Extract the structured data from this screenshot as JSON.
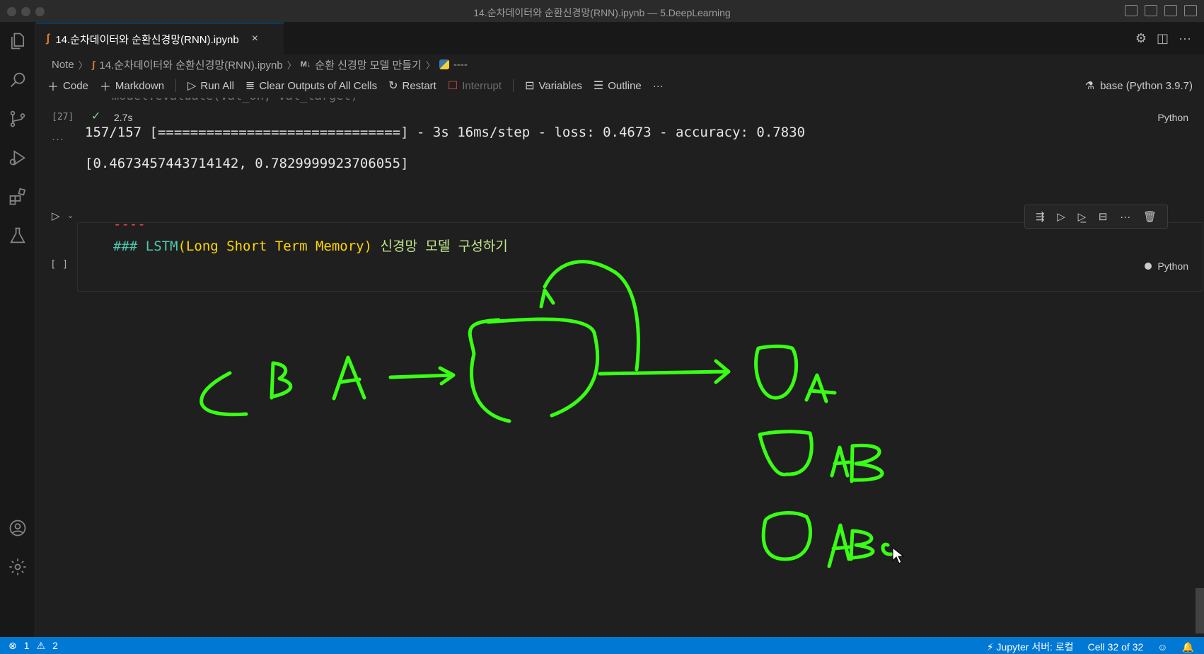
{
  "window": {
    "title": "14.순차데이터와 순환신경망(RNN).ipynb — 5.DeepLearning"
  },
  "tab": {
    "label": "14.순차데이터와 순환신경망(RNN).ipynb",
    "close": "×"
  },
  "breadcrumb": {
    "root": "Note",
    "file": "14.순차데이터와 순환신경망(RNN).ipynb",
    "md_badge": "M↓",
    "section": "순환 신경망 모델 만들기",
    "cell": "----"
  },
  "toolbar": {
    "code": "Code",
    "markdown": "Markdown",
    "run_all": "Run All",
    "clear_outputs": "Clear Outputs of All Cells",
    "restart": "Restart",
    "interrupt": "Interrupt",
    "variables": "Variables",
    "outline": "Outline",
    "more": "···",
    "kernel": "base (Python 3.9.7)"
  },
  "cell27": {
    "code_cut": "model.evaluate(val_oh, val_target)",
    "exec_count": "[27]",
    "duration": "2.7s",
    "language": "Python",
    "more": "···",
    "output_progress": "157/157 [==============================] - 3s 16ms/step - loss: 0.4673 - accuracy: 0.7830",
    "output_result": "[0.4673457443714142, 0.7829999923706055]"
  },
  "cell32": {
    "exec_count": "[ ]",
    "dashes": "----",
    "heading_prefix": "### LSTM",
    "heading_paren": "(Long Short Term Memory)",
    "heading_korean": " 신경망 모델 구성하기",
    "language": "Python"
  },
  "status": {
    "errors": "1",
    "warnings": "2",
    "jupyter": "Jupyter 서버: 로컬",
    "cell_pos": "Cell 32 of 32"
  },
  "colors": {
    "accent": "#0078d4",
    "ink": "#39ff14",
    "status_bar": "#0078d4"
  }
}
